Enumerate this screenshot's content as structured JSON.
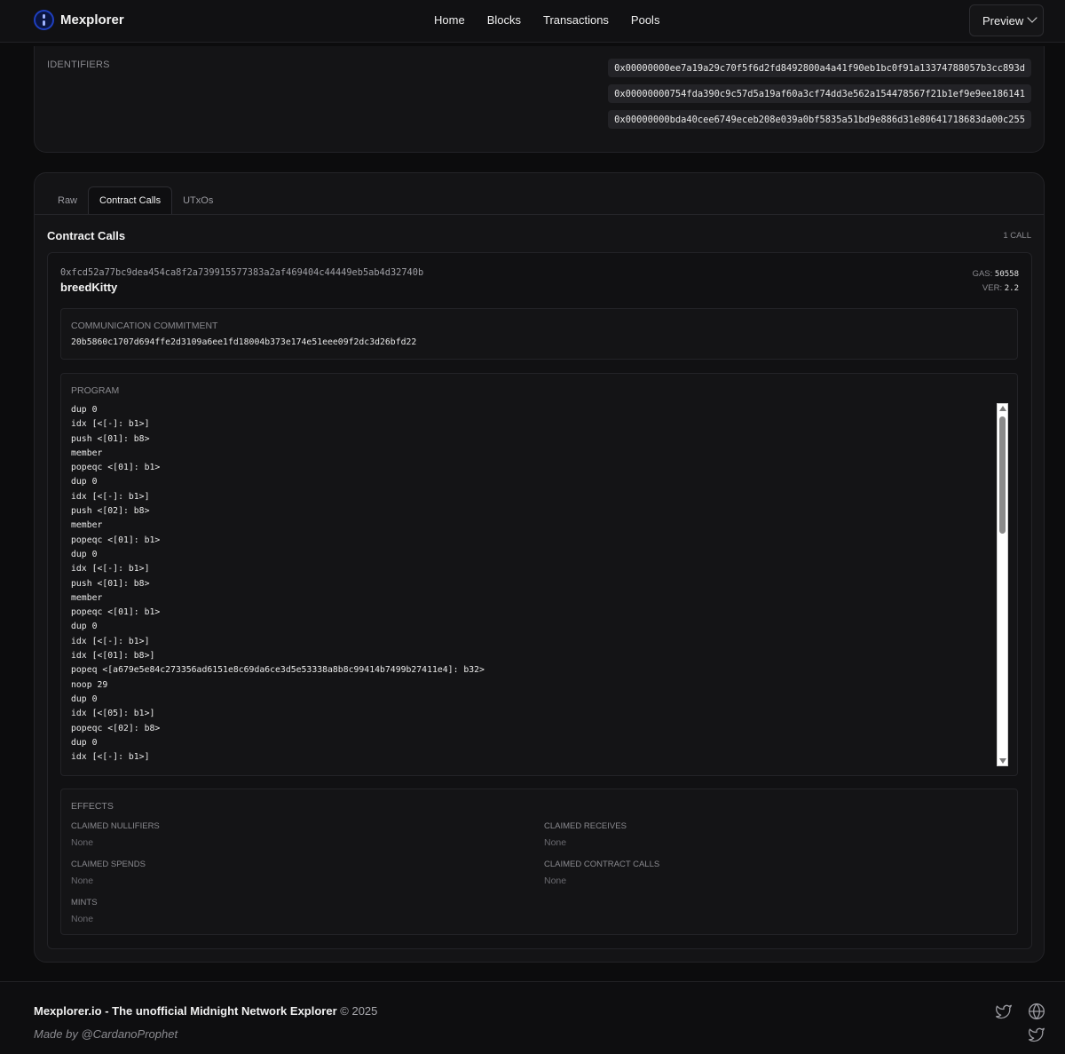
{
  "header": {
    "brand": "Mexplorer",
    "nav": [
      "Home",
      "Blocks",
      "Transactions",
      "Pools"
    ],
    "network_select": "Preview"
  },
  "identifiers": {
    "label": "IDENTIFIERS",
    "values": [
      "0x00000000ee7a19a29c70f5f6d2fd8492800a4a41f90eb1bc0f91a13374788057b3cc893d",
      "0x00000000754fda390c9c57d5a19af60a3cf74dd3e562a154478567f21b1ef9e9ee186141",
      "0x00000000bda40cee6749eceb208e039a0bf5835a51bd9e886d31e80641718683da00c255"
    ]
  },
  "tabs": [
    "Raw",
    "Contract Calls",
    "UTxOs"
  ],
  "active_tab": "Contract Calls",
  "contract_calls": {
    "title": "Contract Calls",
    "count": "1 CALL",
    "call": {
      "address": "0xfcd52a77bc9dea454ca8f2a739915577383a2af469404c44449eb5ab4d32740b",
      "entry_point": "breedKitty",
      "gas_label": "GAS:",
      "gas": "50558",
      "ver_label": "VER:",
      "ver": "2.2",
      "commitment_label": "COMMUNICATION COMMITMENT",
      "commitment": "20b5860c1707d694ffe2d3109a6ee1fd18004b373e174e51eee09f2dc3d26bfd22",
      "program_label": "PROGRAM",
      "program": [
        "dup 0",
        "idx [<[-]: b1>]",
        "push <[01]: b8>",
        "member",
        "popeqc <[01]: b1>",
        "dup 0",
        "idx [<[-]: b1>]",
        "push <[02]: b8>",
        "member",
        "popeqc <[01]: b1>",
        "dup 0",
        "idx [<[-]: b1>]",
        "push <[01]: b8>",
        "member",
        "popeqc <[01]: b1>",
        "dup 0",
        "idx [<[-]: b1>]",
        "idx [<[01]: b8>]",
        "popeq <[a679e5e84c273356ad6151e8c69da6ce3d5e53338a8b8c99414b7499b27411e4]: b32>",
        "noop 29",
        "dup 0",
        "idx [<[05]: b1>]",
        "popeqc <[02]: b8>",
        "dup 0",
        "idx [<[-]: b1>]"
      ],
      "effects": {
        "label": "EFFECTS",
        "claimed_nullifiers_label": "CLAIMED NULLIFIERS",
        "claimed_nullifiers": "None",
        "claimed_receives_label": "CLAIMED RECEIVES",
        "claimed_receives": "None",
        "claimed_spends_label": "CLAIMED SPENDS",
        "claimed_spends": "None",
        "claimed_contract_calls_label": "CLAIMED CONTRACT CALLS",
        "claimed_contract_calls": "None",
        "mints_label": "MINTS",
        "mints": "None"
      }
    }
  },
  "footer": {
    "site": "Mexplorer.io - The unofficial Midnight Network Explorer",
    "copyright": "© 2025",
    "made_by": "Made by @CardanoProphet"
  },
  "icons": [
    "logo-icon",
    "chevron-down-icon",
    "twitter-icon",
    "globe-icon",
    "twitter-icon"
  ]
}
